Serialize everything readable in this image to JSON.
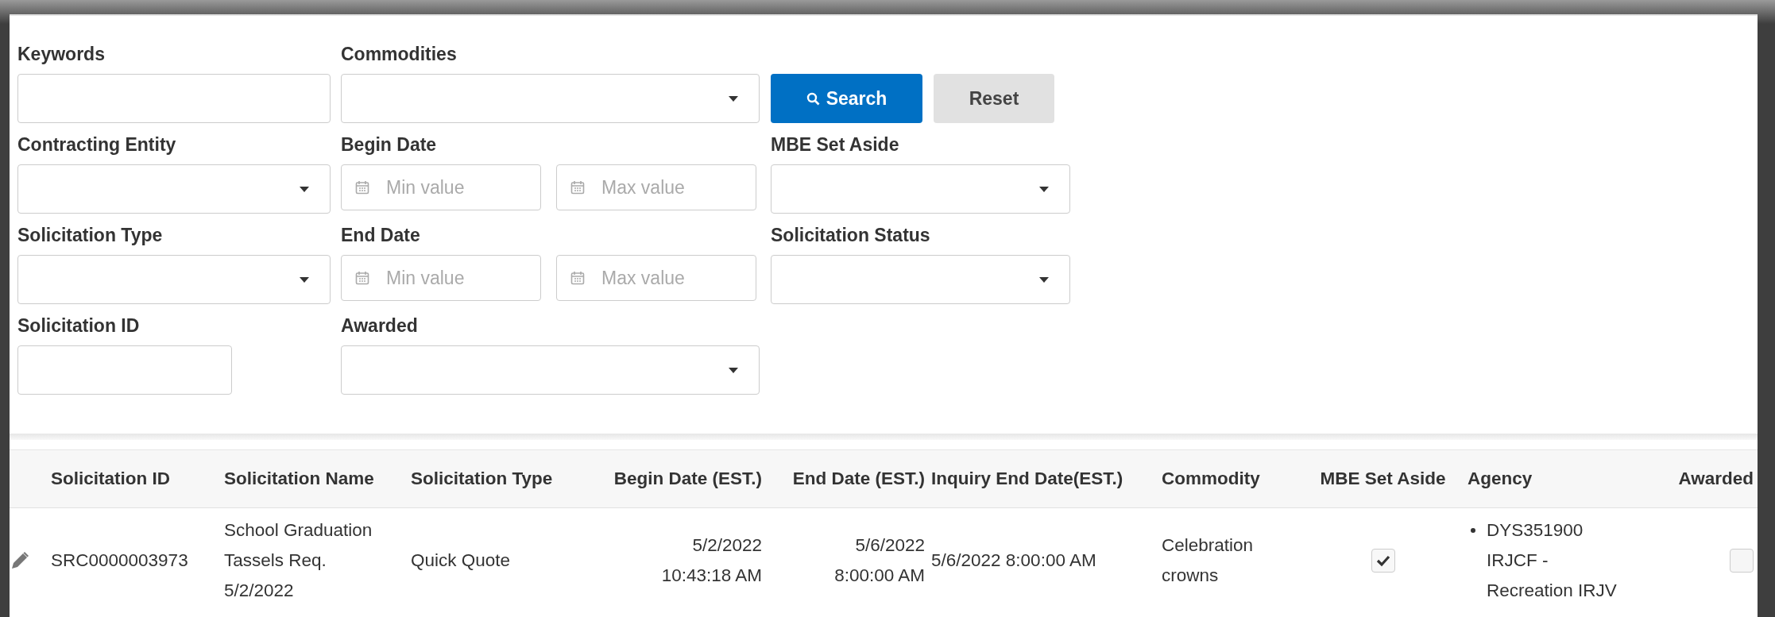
{
  "filter_rows": [
    {
      "fields": [
        {
          "label": "Keywords",
          "kind": "text"
        },
        {
          "label": "Commodities",
          "kind": "select"
        }
      ]
    },
    {
      "fields": [
        {
          "label": "Contracting Entity",
          "kind": "select"
        },
        {
          "label": "Begin Date",
          "kind": "daterange",
          "min_placeholder": "Min value",
          "max_placeholder": "Max value"
        },
        {
          "label": "MBE Set Aside",
          "kind": "select"
        }
      ]
    },
    {
      "fields": [
        {
          "label": "Solicitation Type",
          "kind": "select"
        },
        {
          "label": "End Date",
          "kind": "daterange",
          "min_placeholder": "Min value",
          "max_placeholder": "Max value"
        },
        {
          "label": "Solicitation Status",
          "kind": "select"
        }
      ]
    },
    {
      "fields": [
        {
          "label": "Solicitation ID",
          "kind": "short_text"
        },
        {
          "label": "Awarded",
          "kind": "select"
        }
      ]
    }
  ],
  "search_button": {
    "label": "Search"
  },
  "reset_button": {
    "label": "Reset"
  },
  "table": {
    "columns": [
      {
        "label": "Solicitation ID"
      },
      {
        "label": "Solicitation Name"
      },
      {
        "label": "Solicitation Type"
      },
      {
        "label": "Begin Date (EST.)"
      },
      {
        "label": "End Date (EST.)"
      },
      {
        "label": "Inquiry End Date(EST.)"
      },
      {
        "label": "Commodity"
      },
      {
        "label": "MBE Set Aside"
      },
      {
        "label": "Agency"
      },
      {
        "label": "Awarded"
      }
    ],
    "rows": [
      {
        "cells": [
          {
            "kind": "text",
            "lines": [
              "SRC0000003973"
            ]
          },
          {
            "kind": "text",
            "lines": [
              "School Graduation",
              "Tassels Req.",
              "5/2/2022"
            ]
          },
          {
            "kind": "text",
            "lines": [
              "Quick Quote"
            ]
          },
          {
            "kind": "text",
            "lines": [
              "5/2/2022",
              "10:43:18 AM"
            ]
          },
          {
            "kind": "text",
            "lines": [
              "5/6/2022",
              "8:00:00 AM"
            ]
          },
          {
            "kind": "text",
            "lines": [
              "5/6/2022 8:00:00 AM"
            ]
          },
          {
            "kind": "text",
            "lines": [
              "Celebration",
              "crowns"
            ]
          },
          {
            "kind": "checkbox",
            "checked": true
          },
          {
            "kind": "list",
            "items": [
              {
                "lines": [
                  "DYS351900",
                  "IRJCF -",
                  "Recreation IRJV"
                ]
              }
            ]
          },
          {
            "kind": "checkbox",
            "checked": false
          }
        ]
      }
    ]
  }
}
